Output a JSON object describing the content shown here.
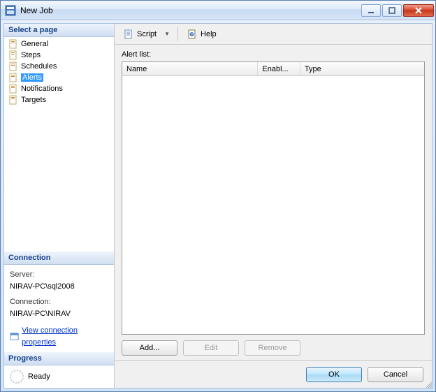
{
  "window": {
    "title": "New Job"
  },
  "sidebar": {
    "select_page": "Select a page",
    "items": [
      {
        "label": "General"
      },
      {
        "label": "Steps"
      },
      {
        "label": "Schedules"
      },
      {
        "label": "Alerts"
      },
      {
        "label": "Notifications"
      },
      {
        "label": "Targets"
      }
    ],
    "selected_index": 3
  },
  "connection": {
    "header": "Connection",
    "server_label": "Server:",
    "server_value": "NIRAV-PC\\sql2008",
    "conn_label": "Connection:",
    "conn_value": "NIRAV-PC\\NIRAV",
    "view_props": "View connection properties"
  },
  "progress": {
    "header": "Progress",
    "status": "Ready"
  },
  "toolbar": {
    "script_label": "Script",
    "help_label": "Help"
  },
  "main": {
    "alert_list_label": "Alert list:",
    "columns": {
      "name": "Name",
      "enabled": "Enabl...",
      "type": "Type"
    },
    "rows": []
  },
  "actions": {
    "add": "Add...",
    "edit": "Edit",
    "remove": "Remove"
  },
  "footer": {
    "ok": "OK",
    "cancel": "Cancel"
  }
}
